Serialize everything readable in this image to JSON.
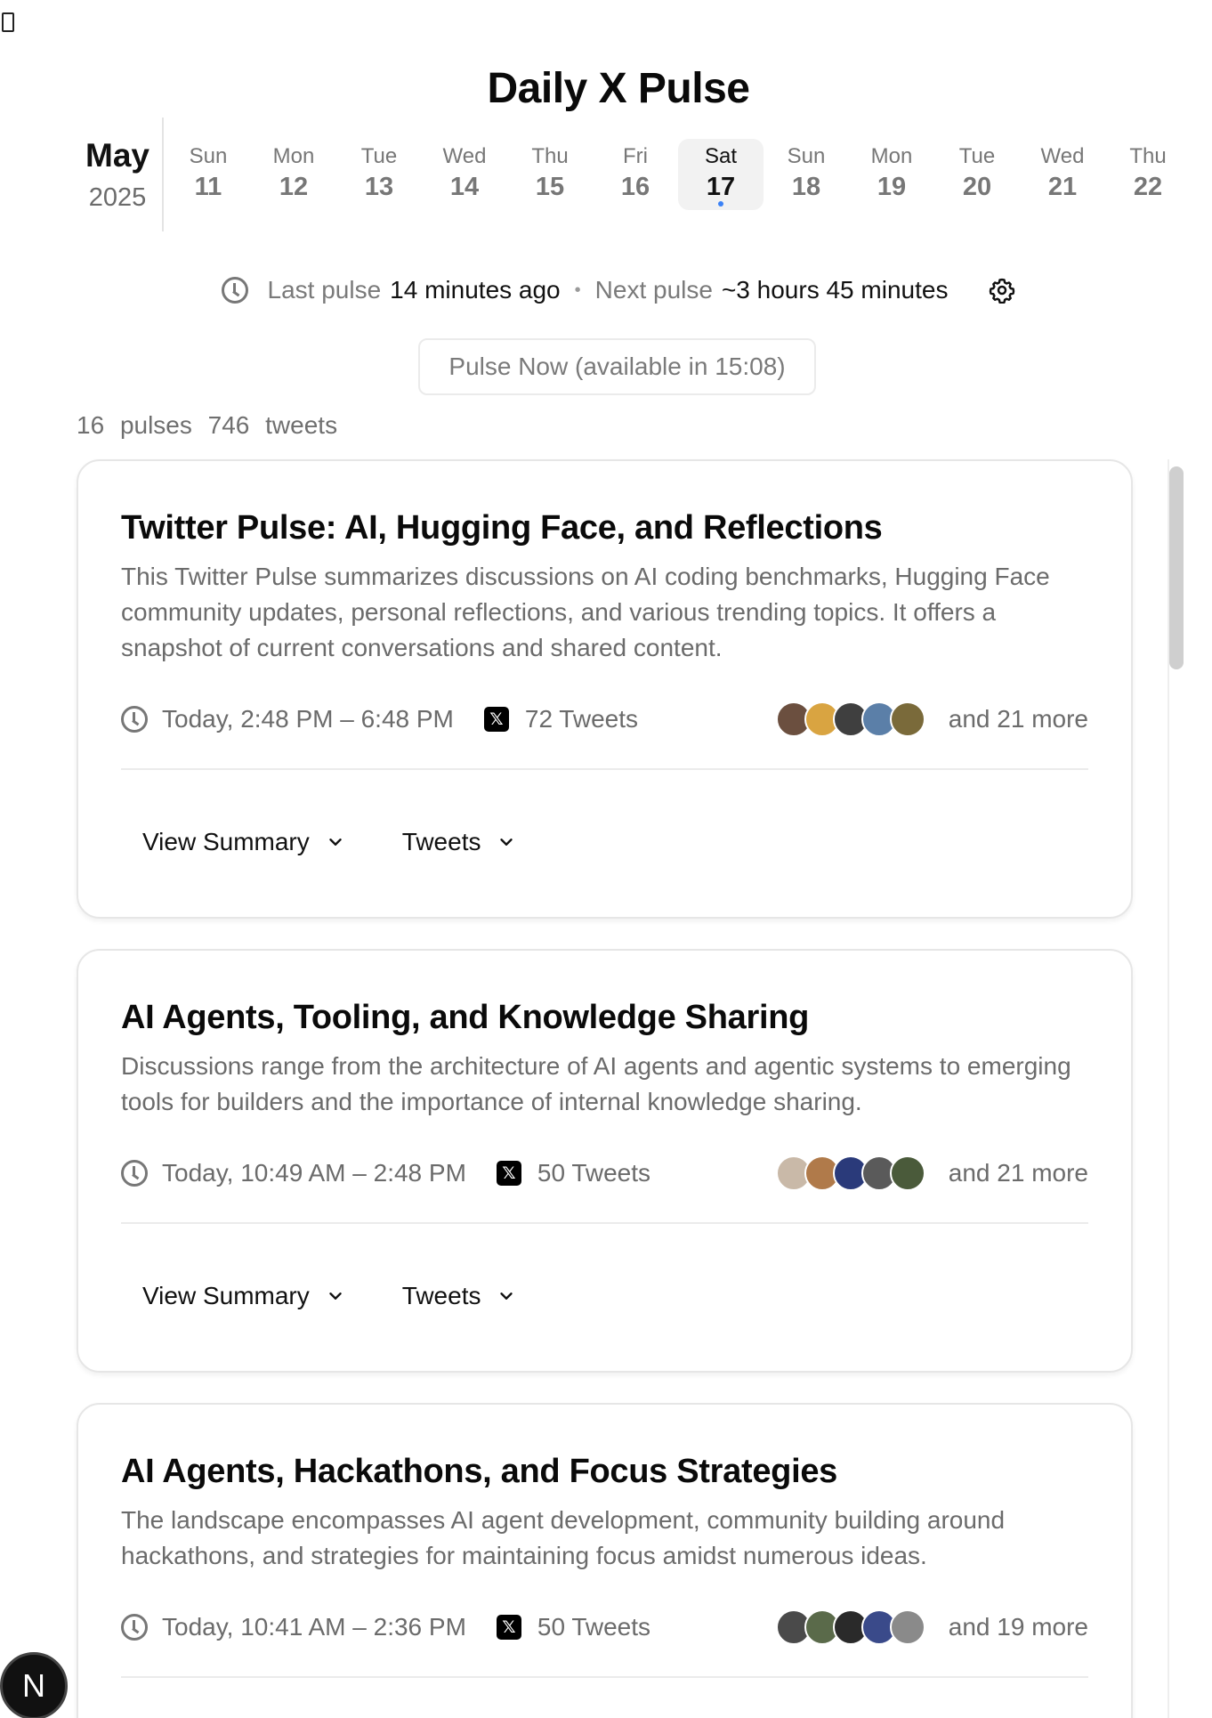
{
  "app": {
    "title": "Daily X Pulse"
  },
  "calendar": {
    "month": "May",
    "year": "2025",
    "days": [
      {
        "dow": "Sun",
        "dom": "11",
        "selected": false
      },
      {
        "dow": "Mon",
        "dom": "12",
        "selected": false
      },
      {
        "dow": "Tue",
        "dom": "13",
        "selected": false
      },
      {
        "dow": "Wed",
        "dom": "14",
        "selected": false
      },
      {
        "dow": "Thu",
        "dom": "15",
        "selected": false
      },
      {
        "dow": "Fri",
        "dom": "16",
        "selected": false
      },
      {
        "dow": "Sat",
        "dom": "17",
        "selected": true
      },
      {
        "dow": "Sun",
        "dom": "18",
        "selected": false
      },
      {
        "dow": "Mon",
        "dom": "19",
        "selected": false
      },
      {
        "dow": "Tue",
        "dom": "20",
        "selected": false
      },
      {
        "dow": "Wed",
        "dom": "21",
        "selected": false
      },
      {
        "dow": "Thu",
        "dom": "22",
        "selected": false
      }
    ]
  },
  "status": {
    "last_label": "Last pulse",
    "last_value": "14 minutes ago",
    "next_label": "Next pulse",
    "next_value": "~3 hours 45 minutes",
    "separator": "•"
  },
  "pulse_now": {
    "label": "Pulse Now (available in 15:08)"
  },
  "counts": {
    "pulses": "16",
    "pulses_label": "pulses",
    "tweets": "746",
    "tweets_label": "tweets"
  },
  "cards": [
    {
      "title": "Twitter Pulse: AI, Hugging Face, and Reflections",
      "description": "This Twitter Pulse summarizes discussions on AI coding benchmarks, Hugging Face community updates, personal reflections, and various trending topics. It offers a snapshot of current conversations and shared content.",
      "time": "Today, 2:48 PM – 6:48 PM",
      "tweets": "72 Tweets",
      "more": "and 21 more",
      "avatar_colors": [
        "#6b4f3f",
        "#d9a441",
        "#3f3f3f",
        "#5b7fa8",
        "#7a6a3a"
      ],
      "summary_label": "View Summary",
      "tweets_label": "Tweets"
    },
    {
      "title": "AI Agents, Tooling, and Knowledge Sharing",
      "description": "Discussions range from the architecture of AI agents and agentic systems to emerging tools for builders and the importance of internal knowledge sharing.",
      "time": "Today, 10:49 AM – 2:48 PM",
      "tweets": "50 Tweets",
      "more": "and 21 more",
      "avatar_colors": [
        "#c9b9a8",
        "#b07a4a",
        "#2a3a7a",
        "#5a5a5a",
        "#4a5a3a"
      ],
      "summary_label": "View Summary",
      "tweets_label": "Tweets"
    },
    {
      "title": "AI Agents, Hackathons, and Focus Strategies",
      "description": "The landscape encompasses AI agent development, community building around hackathons, and strategies for maintaining focus amidst numerous ideas.",
      "time": "Today, 10:41 AM – 2:36 PM",
      "tweets": "50 Tweets",
      "more": "and 19 more",
      "avatar_colors": [
        "#4a4a4a",
        "#5a6a4a",
        "#2a2a2a",
        "#3a4a8a",
        "#8a8a8a"
      ]
    }
  ],
  "fab": {
    "label": "N"
  }
}
